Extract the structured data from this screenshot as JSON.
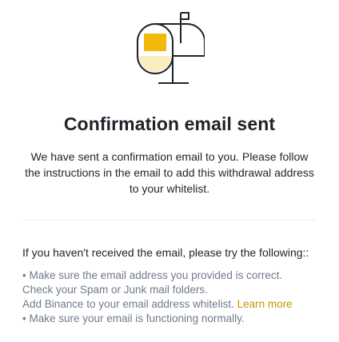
{
  "illustration": {
    "icon": "mailbox-icon",
    "colors": {
      "stroke": "#1e2329",
      "accent": "#f0b90b"
    }
  },
  "title": "Confirmation email sent",
  "description": "We have sent a confirmation email to you. Please follow the instructions in the email to add this withdrawal address to your whitelist.",
  "tips": {
    "heading": "If you haven't received the email, please try the following::",
    "item1": "• Make sure the email address you provided is correct.",
    "item2": "Check your Spam or Junk mail folders.",
    "item3_text": "Add Binance to your email address whitelist. ",
    "item3_link": "Learn more",
    "item4": "• Make sure your email is functioning normally."
  },
  "colors": {
    "text_primary": "#1e2329",
    "text_secondary": "#707a8a",
    "link": "#c99400",
    "divider": "#eaecef"
  }
}
